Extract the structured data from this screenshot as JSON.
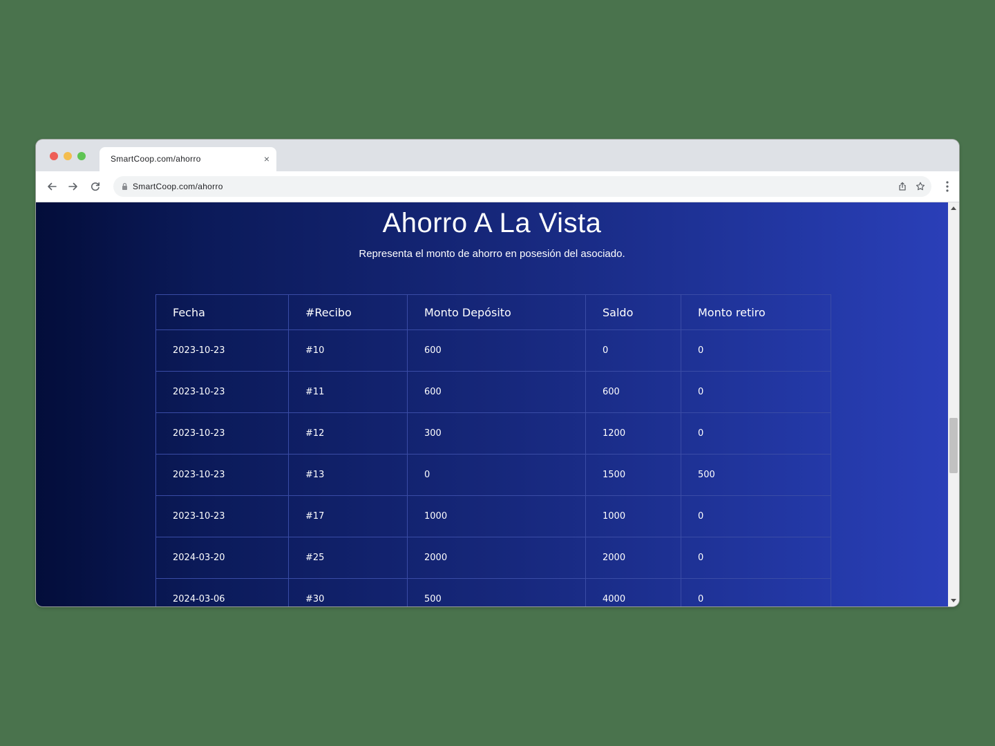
{
  "browser": {
    "tab_title": "SmartCoop.com/ahorro",
    "tab_close": "×",
    "url": "SmartCoop.com/ahorro"
  },
  "page": {
    "title": "Ahorro A La Vista",
    "subtitle": "Representa el monto de ahorro en posesión del asociado."
  },
  "table": {
    "headers": [
      "Fecha",
      "#Recibo",
      "Monto Depósito",
      "Saldo",
      "Monto retiro"
    ],
    "rows": [
      [
        "2023-10-23",
        "#10",
        "600",
        "0",
        "0"
      ],
      [
        "2023-10-23",
        "#11",
        "600",
        "600",
        "0"
      ],
      [
        "2023-10-23",
        "#12",
        "300",
        "1200",
        "0"
      ],
      [
        "2023-10-23",
        "#13",
        "0",
        "1500",
        "500"
      ],
      [
        "2023-10-23",
        "#17",
        "1000",
        "1000",
        "0"
      ],
      [
        "2024-03-20",
        "#25",
        "2000",
        "2000",
        "0"
      ],
      [
        "2024-03-06",
        "#30",
        "500",
        "4000",
        "0"
      ]
    ]
  },
  "icons": {
    "back": "arrow-left-icon",
    "forward": "arrow-right-icon",
    "reload": "reload-icon",
    "lock": "lock-icon",
    "share": "share-icon",
    "bookmark": "star-icon",
    "menu": "kebab-menu-icon",
    "scroll_top": "chevron-up-icon"
  },
  "colors": {
    "page_bg": "#4a734d",
    "content_gradient_start": "#030d3a",
    "content_gradient_end": "#2a3fb8",
    "scroll_top_button": "#2554b4"
  }
}
